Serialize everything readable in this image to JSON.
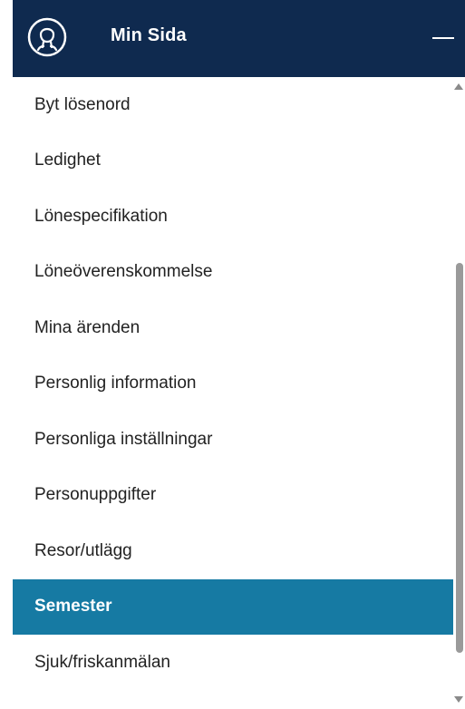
{
  "header": {
    "title": "Min Sida",
    "avatar_icon": "user-circle-icon",
    "collapse_icon": "minus-icon",
    "background": "#0f2a4f"
  },
  "menu": {
    "items": [
      {
        "label": "Byt lösenord"
      },
      {
        "label": "Ledighet"
      },
      {
        "label": "Lönespecifikation"
      },
      {
        "label": "Löneöverenskommelse"
      },
      {
        "label": "Mina ärenden"
      },
      {
        "label": "Personlig information"
      },
      {
        "label": "Personliga inställningar"
      },
      {
        "label": "Personuppgifter"
      },
      {
        "label": "Resor/utlägg"
      },
      {
        "label": "Semester",
        "active": true
      },
      {
        "label": "Sjuk/friskanmälan"
      }
    ],
    "active_color": "#167aa3"
  }
}
